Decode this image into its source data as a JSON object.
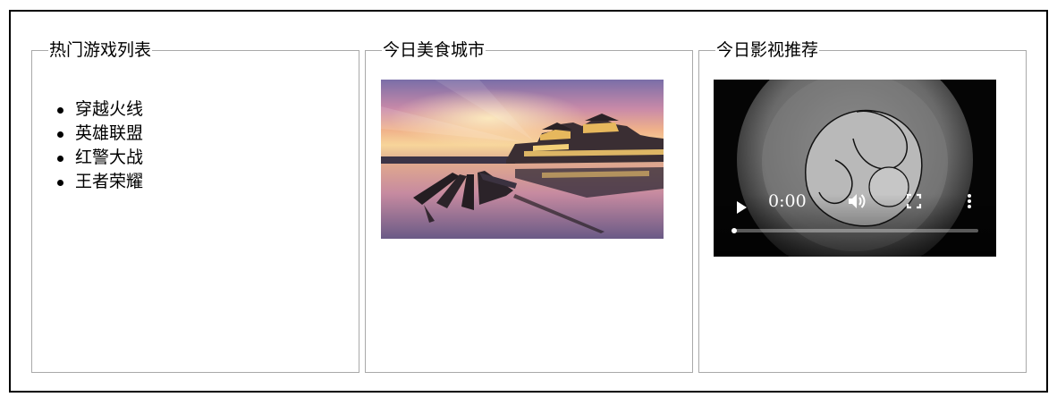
{
  "games_panel": {
    "title": "热门游戏列表",
    "items": [
      "穿越火线",
      "英雄联盟",
      "红警大战",
      "王者荣耀"
    ]
  },
  "photo_panel": {
    "title": "今日美食城市",
    "image": "sunset lake with palace buildings and dragon boats"
  },
  "video_panel": {
    "title": "今日影视推荐",
    "time": "0:00",
    "progress": 0
  }
}
